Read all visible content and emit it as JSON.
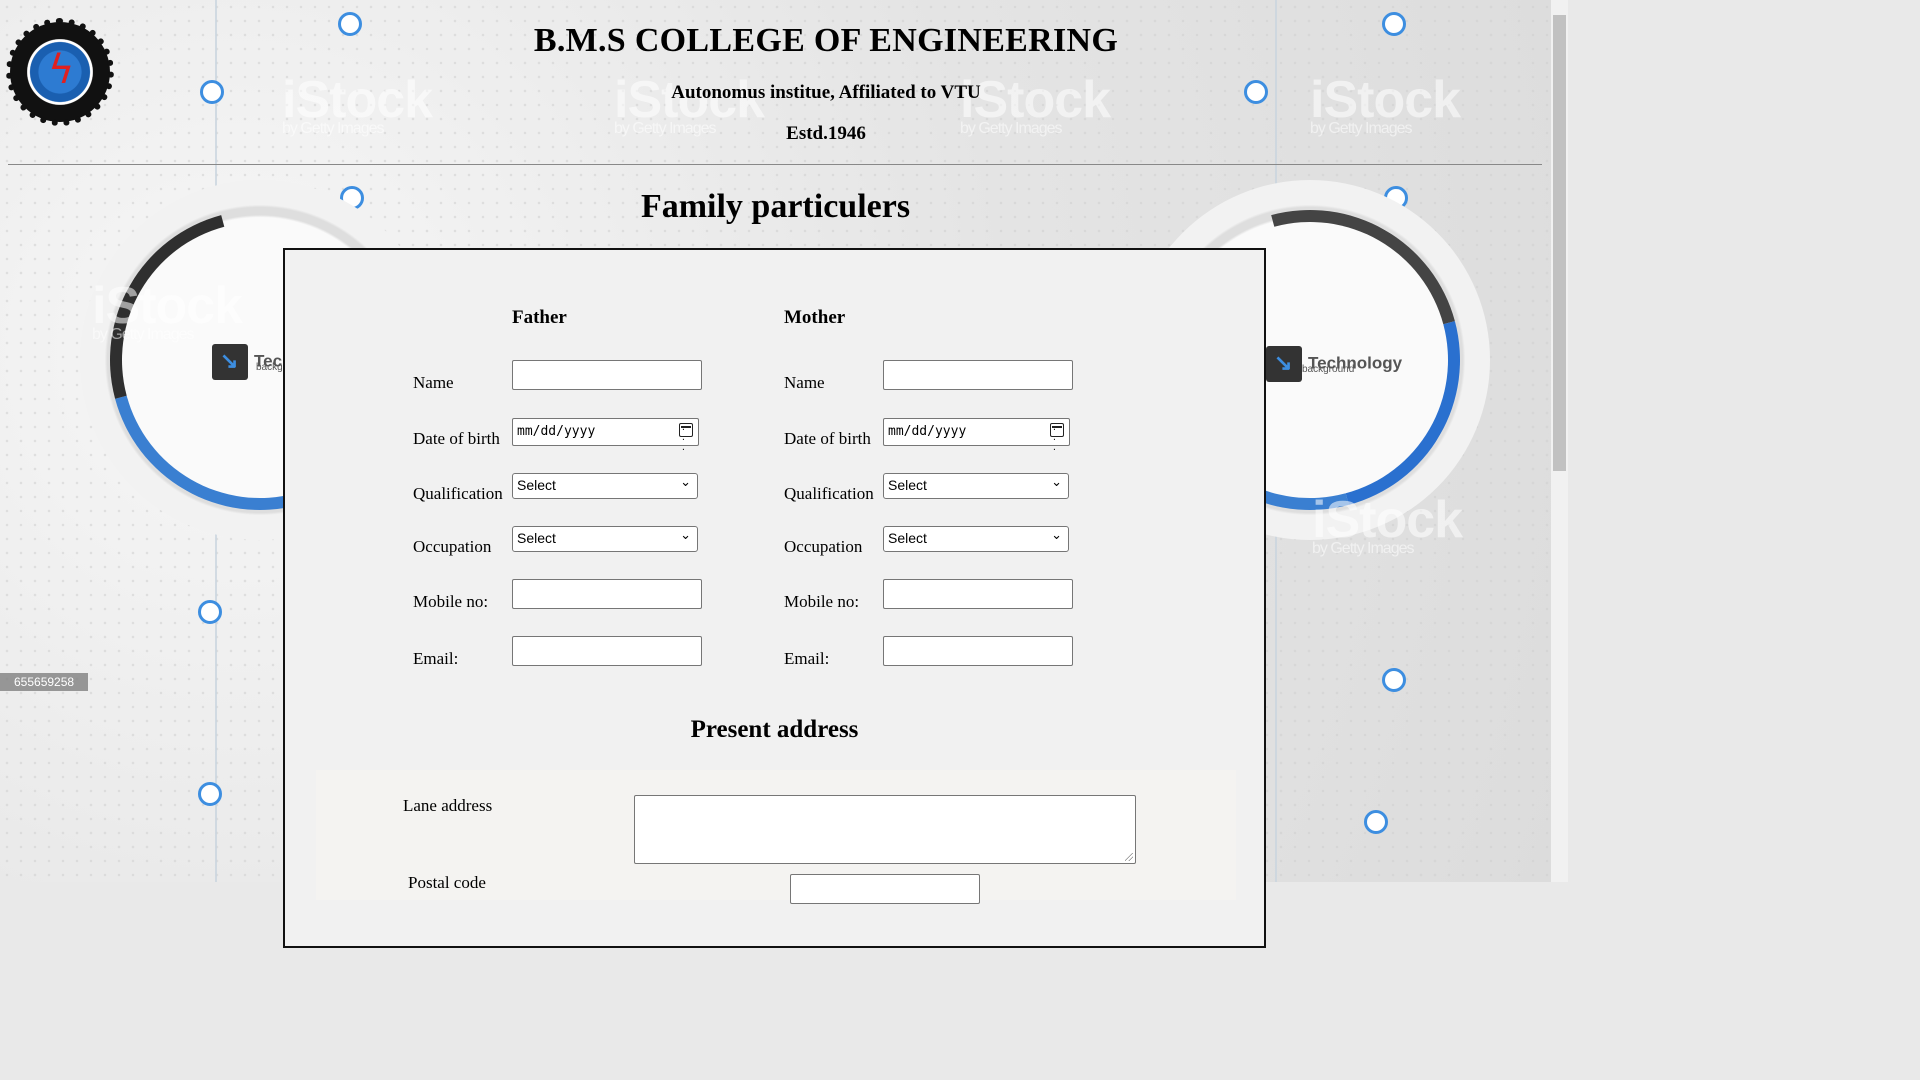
{
  "header": {
    "college_name": "B.M.S COLLEGE OF ENGINEERING",
    "subtitle": "Autonomus institue, Affiliated to VTU",
    "established": "Estd.1946"
  },
  "page_title": "Family particulers",
  "background": {
    "tech_label": "Technology",
    "tech_sub": "background",
    "tech_label_cut": "Tec",
    "tech_sub_cut": "backg",
    "watermark": "iStock",
    "watermark_sub": "by Getty Images",
    "stock_id": "655659258"
  },
  "father": {
    "heading": "Father",
    "name_label": "Name",
    "dob_label": "Date of birth",
    "dob_placeholder": "mm/dd/yyyy",
    "qualification_label": "Qualification",
    "qualification_value": "Select",
    "occupation_label": "Occupation",
    "occupation_value": "Select",
    "mobile_label": "Mobile no:",
    "email_label": "Email:"
  },
  "mother": {
    "heading": "Mother",
    "name_label": "Name",
    "dob_label": "Date of birth",
    "dob_placeholder": "mm/dd/yyyy",
    "qualification_label": "Qualification",
    "qualification_value": "Select",
    "occupation_label": "Occupation",
    "occupation_value": "Select",
    "mobile_label": "Mobile no:",
    "email_label": "Email:"
  },
  "address": {
    "heading": "Present address",
    "lane_label": "Lane address",
    "postal_label": "Postal code"
  }
}
